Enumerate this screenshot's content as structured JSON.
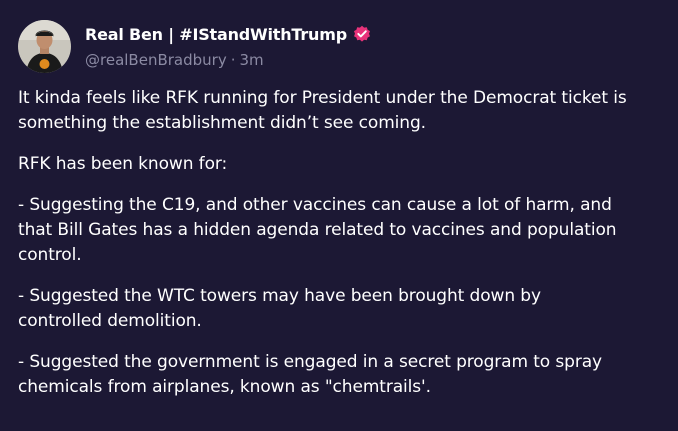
{
  "post": {
    "author": {
      "display_name": "Real Ben | #IStandWithTrump",
      "handle": "@realBenBradbury",
      "time_ago": "3m",
      "separator": "·",
      "avatar": "avatar-icon",
      "verified_badge": "verified-badge-icon",
      "badge_color": "#e8327a"
    },
    "paragraphs": [
      "It kinda feels like RFK running for President under the Democrat ticket is\nsomething the establishment didn’t see coming.",
      "RFK has been known for:",
      "- Suggesting the C19, and other vaccines can cause a lot of harm, and\nthat Bill Gates has a hidden agenda related to vaccines and population\ncontrol.",
      "- Suggested the WTC towers may have been brought down by\ncontrolled demolition.",
      "- Suggested the government is engaged in a secret program to spray\nchemicals from airplanes, known as \"chemtrails'."
    ],
    "colors": {
      "background": "#1c1834",
      "text": "#ffffff",
      "muted": "#8b8aa3"
    }
  }
}
